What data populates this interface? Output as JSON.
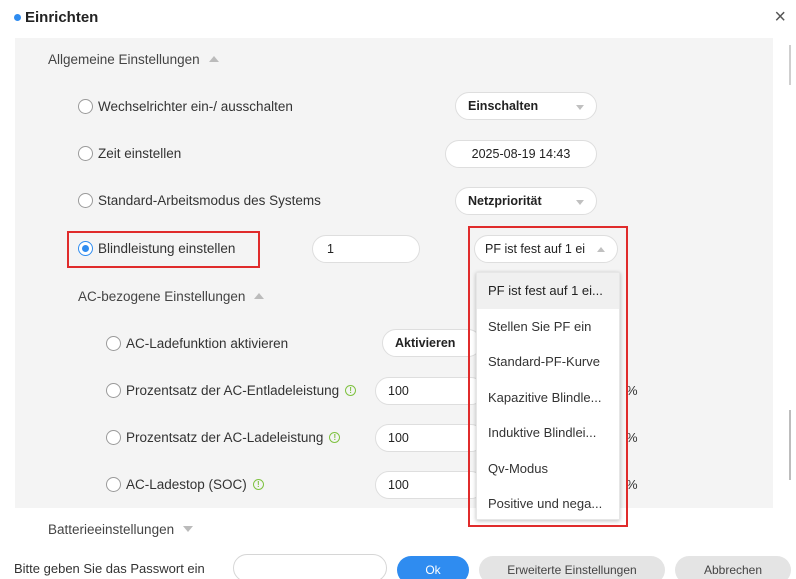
{
  "dialog": {
    "title": "Einrichten",
    "close_symbol": "×"
  },
  "sections": {
    "general": "Allgemeine Einstellungen",
    "ac": "AC-bezogene Einstellungen",
    "battery": "Batterieeinstellungen"
  },
  "rows": {
    "inverter_toggle": {
      "label": "Wechselrichter ein-/ ausschalten",
      "value": "Einschalten"
    },
    "set_time": {
      "label": "Zeit einstellen",
      "value": "2025-08-19 14:43"
    },
    "work_mode": {
      "label": "Standard-Arbeitsmodus des Systems",
      "value": "Netzpriorität"
    },
    "reactive_power": {
      "label": "Blindleistung einstellen",
      "input_value": "1",
      "select_value": "PF ist fest auf 1 ei"
    },
    "ac_charge": {
      "label": "AC-Ladefunktion aktivieren",
      "value": "Aktivieren"
    },
    "ac_discharge_pct": {
      "label": "Prozentsatz der AC-Entladeleistung",
      "value": "100",
      "unit": "%"
    },
    "ac_charge_pct": {
      "label": "Prozentsatz der AC-Ladeleistung",
      "value": "100",
      "unit": "%"
    },
    "ac_stop_soc": {
      "label": "AC-Ladestop (SOC)",
      "value": "100",
      "unit": "%"
    }
  },
  "dropdown_options": [
    "PF ist fest auf 1 ei...",
    "Stellen Sie PF ein",
    "Standard-PF-Kurve",
    "Kapazitive Blindle...",
    "Induktive Blindlei...",
    "Qv-Modus",
    "Positive und nega..."
  ],
  "footer": {
    "password_label": "Bitte geben Sie das Passwort ein",
    "ok_label": "Ok",
    "advanced_label": "Erweiterte Einstellungen",
    "cancel_label": "Abbrechen"
  },
  "colors": {
    "accent": "#2f8cf0",
    "highlight": "#e02b2b",
    "info": "#7fc241"
  }
}
